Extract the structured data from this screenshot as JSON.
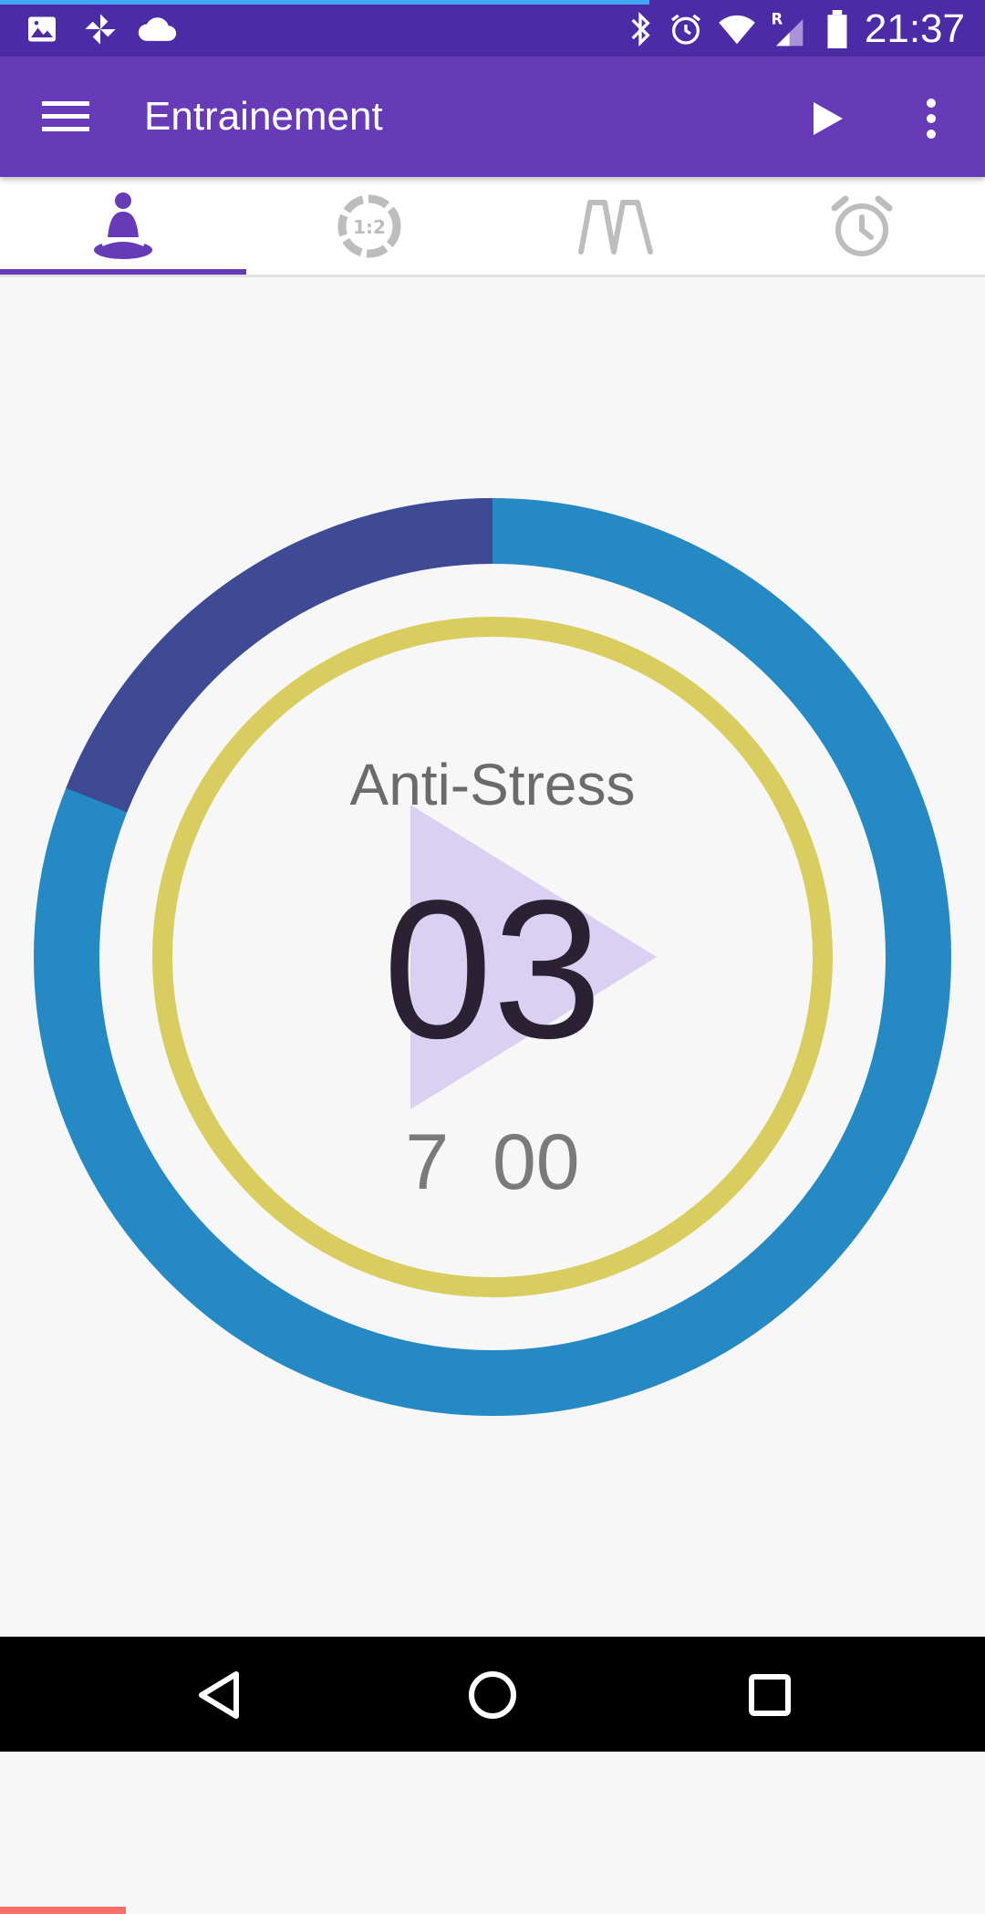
{
  "status_bar": {
    "time": "21:37",
    "icons": [
      "image-icon",
      "pinwheel-icon",
      "cloud-icon",
      "bluetooth-icon",
      "alarm-icon",
      "wifi-icon",
      "signal-roaming-icon",
      "battery-icon"
    ],
    "roaming_label": "R"
  },
  "app_bar": {
    "title": "Entrainement",
    "menu_icon": "hamburger-menu-icon",
    "play_icon": "play-icon",
    "more_icon": "more-vert-icon"
  },
  "tabs": [
    {
      "name": "meditation",
      "icon": "meditation-icon",
      "selected": true
    },
    {
      "name": "ratio",
      "icon": "ratio-timer-icon",
      "label": "1:2",
      "selected": false
    },
    {
      "name": "breathing-pattern",
      "icon": "breathing-pattern-icon",
      "selected": false
    },
    {
      "name": "alarm",
      "icon": "alarm-clock-icon",
      "selected": false
    }
  ],
  "session": {
    "name": "Anti-Stress",
    "counter": "03",
    "duration": "7  00",
    "outer_ring_progress": 0.19,
    "colors": {
      "ring_main": "#2589c4",
      "ring_progress": "#3f4a94",
      "inner_ring": "#d9cd5f",
      "play_overlay": "#d8cdf0"
    }
  },
  "bottom_progress": 0.128,
  "colors": {
    "status_bar": "#4c2ca6",
    "app_bar": "#673ab7",
    "accent": "#673ab7",
    "bottom_progress": "#ff6e66"
  },
  "nav_bar": {
    "back_icon": "back-triangle-icon",
    "home_icon": "home-circle-icon",
    "recents_icon": "recents-square-icon"
  }
}
